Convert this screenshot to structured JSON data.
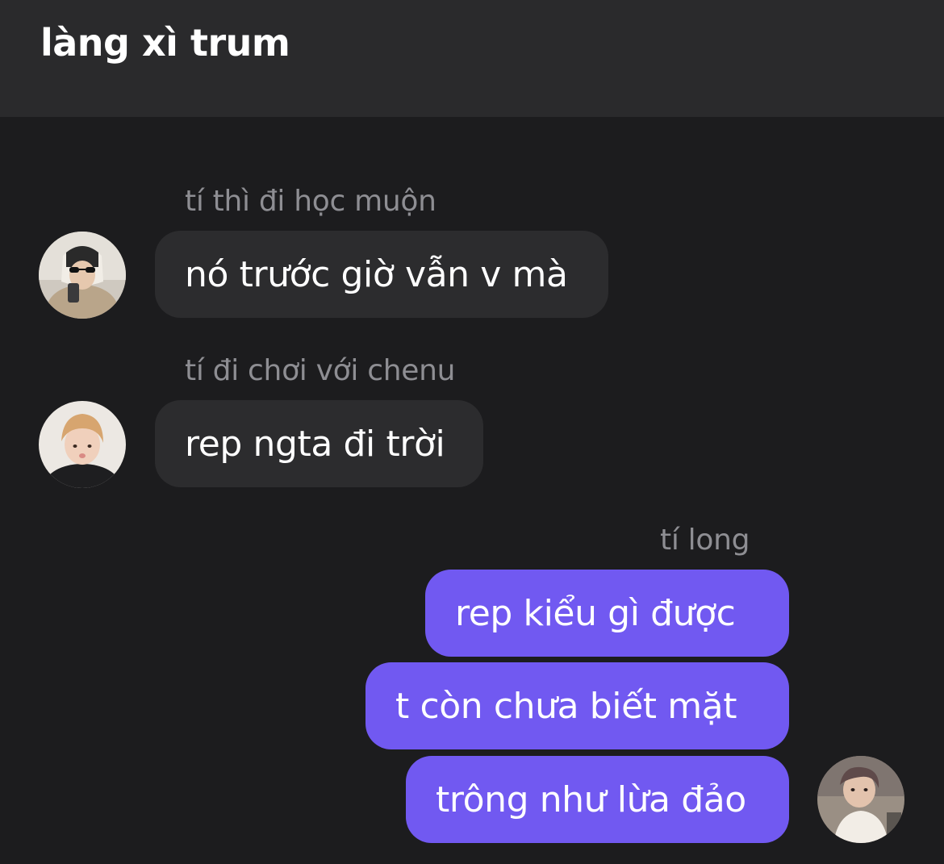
{
  "header": {
    "title": "làng xì trum"
  },
  "messages": [
    {
      "sender": "tí thì đi học muộn",
      "text": "nó trước giờ vẫn v mà",
      "direction": "incoming",
      "avatar": "avatar-person-sunglasses"
    },
    {
      "sender": "tí đi chơi với chenu",
      "text": "rep ngta đi trời",
      "direction": "incoming",
      "avatar": "avatar-person-blonde"
    },
    {
      "sender": "tí long",
      "direction": "outgoing",
      "avatar": "avatar-person-self",
      "texts": [
        "rep kiểu gì được",
        "t còn chưa biết mặt",
        "trông như lừa đảo"
      ]
    }
  ],
  "colors": {
    "background": "#1c1c1e",
    "header": "#2a2a2c",
    "incoming_bubble": "#2c2c2e",
    "outgoing_bubble": "#7159f1",
    "sender_text": "#8e8e93"
  }
}
